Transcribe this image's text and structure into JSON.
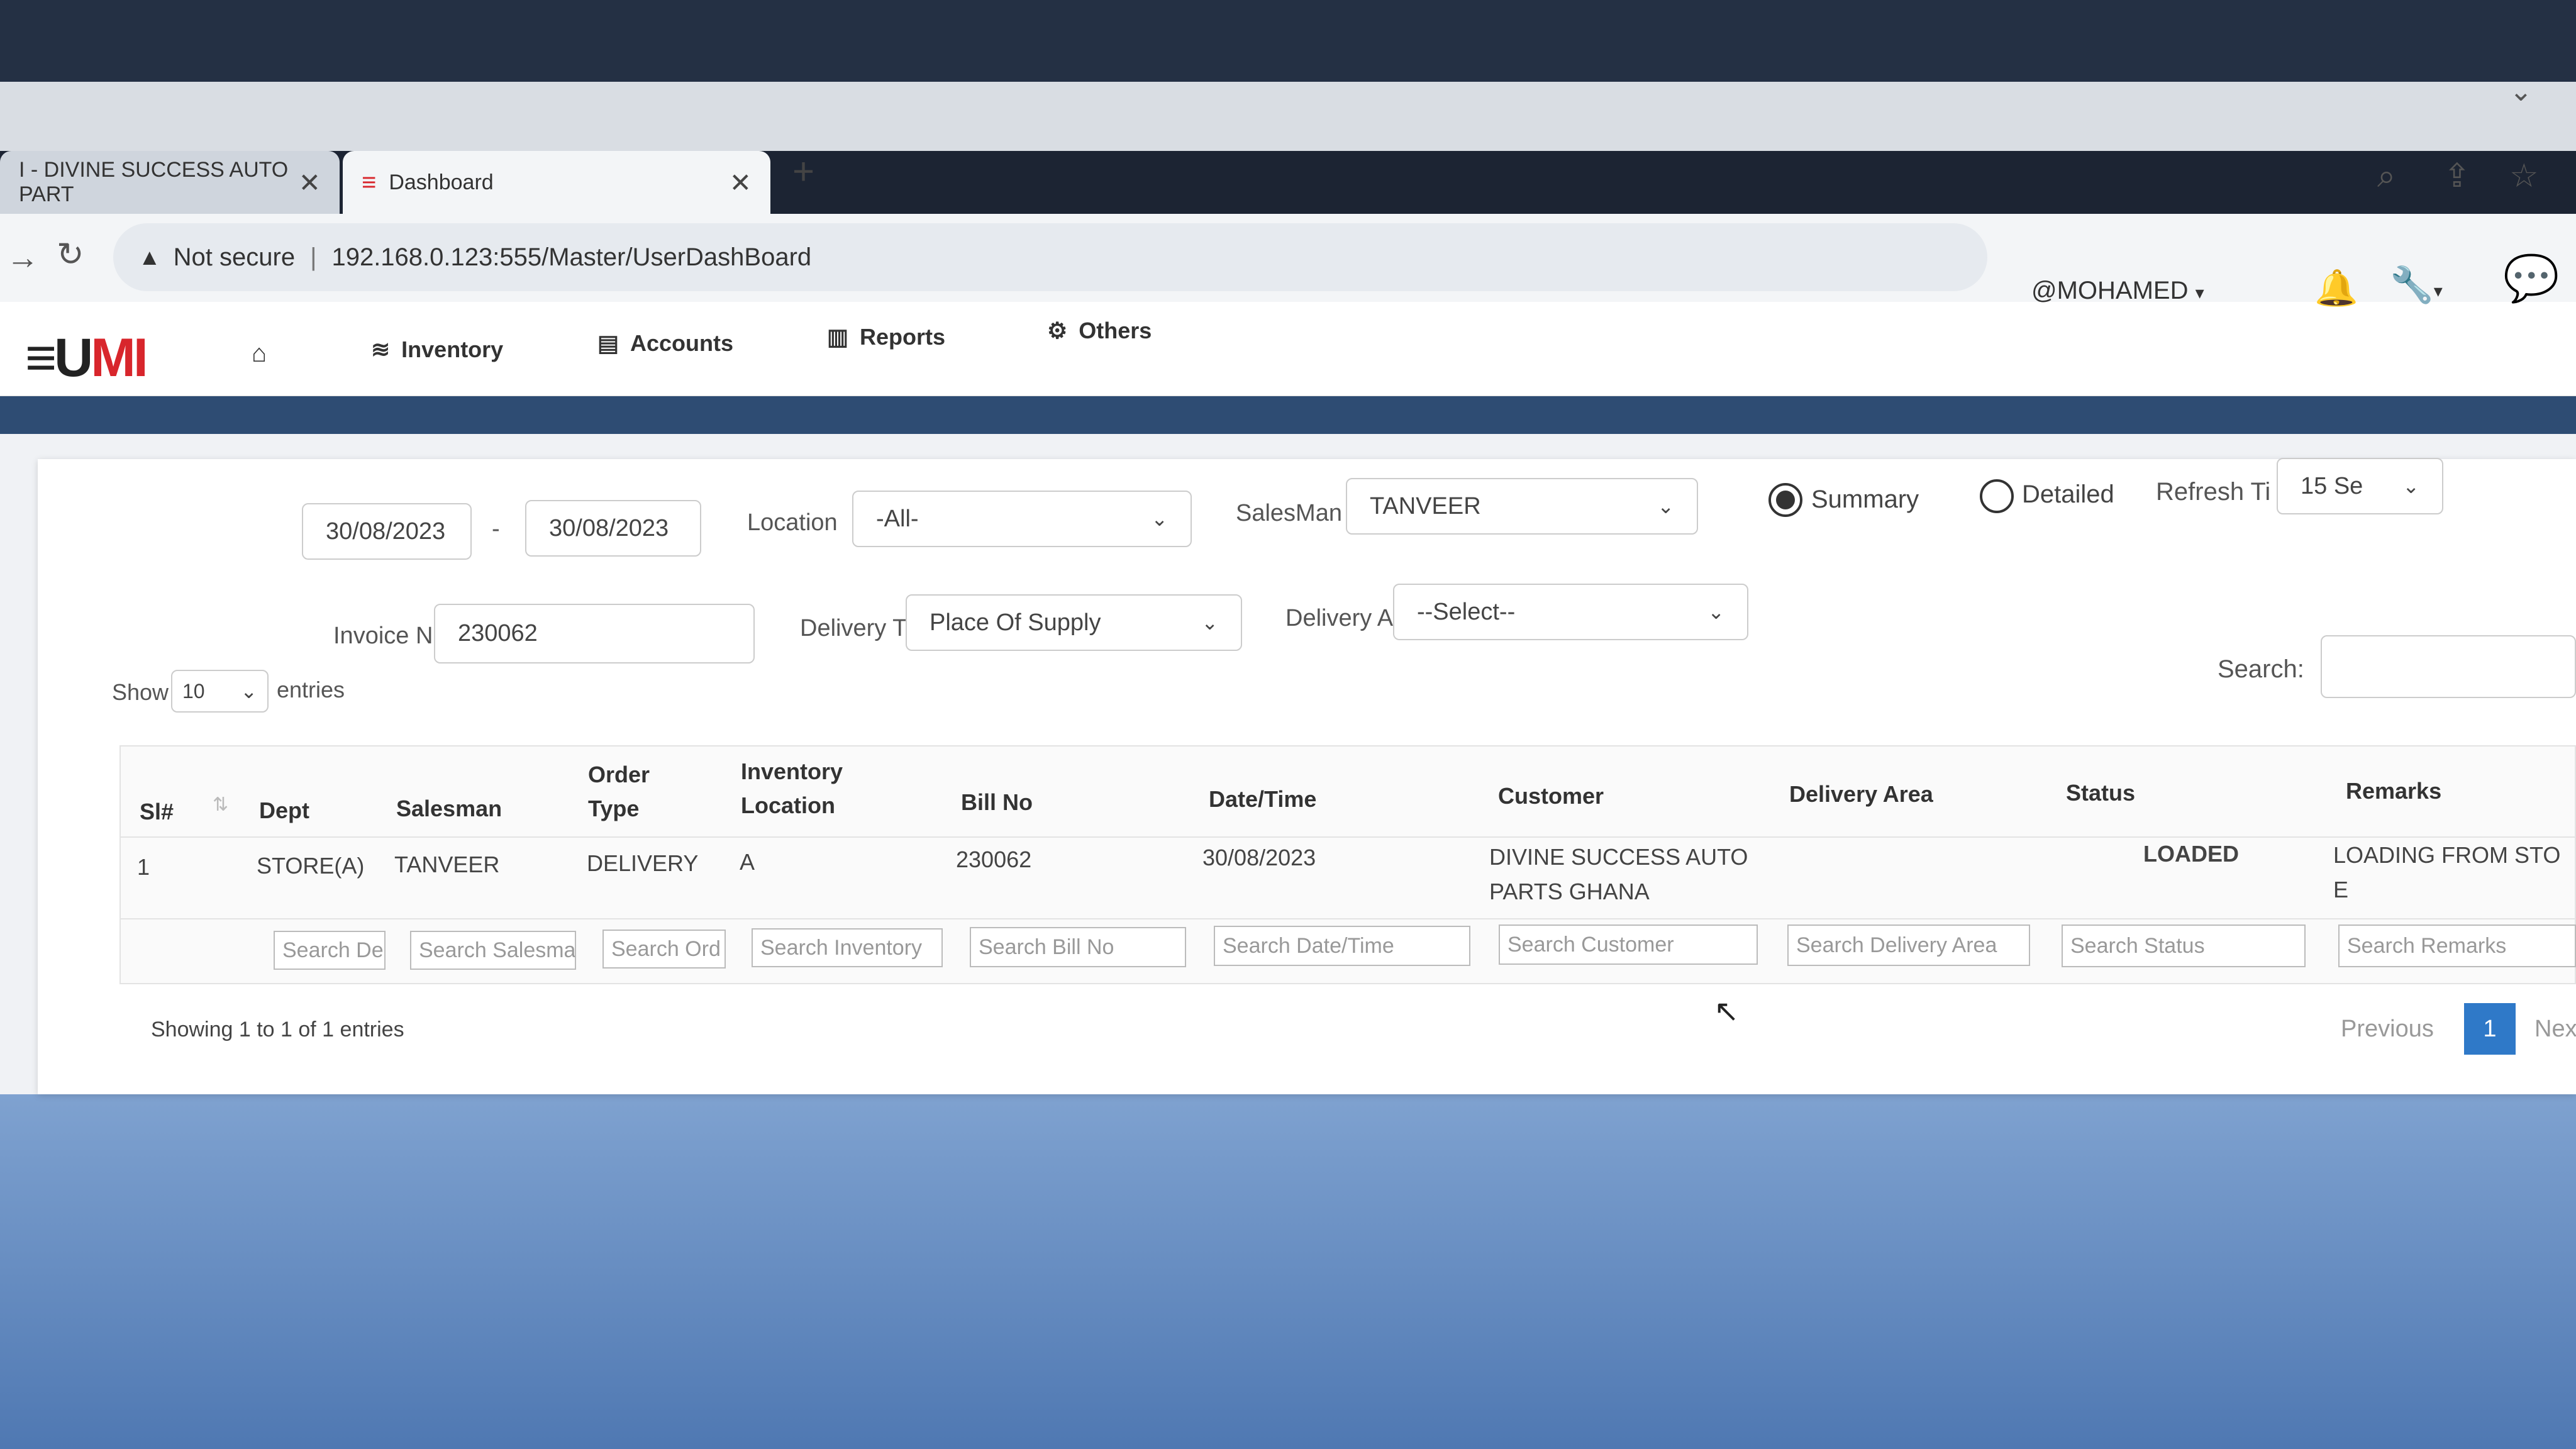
{
  "browser": {
    "tabs": [
      {
        "label": "I - DIVINE SUCCESS AUTO PART",
        "active": false
      },
      {
        "label": "Dashboard",
        "active": true
      }
    ],
    "security_label": "Not secure",
    "url": "192.168.0.123:555/Master/UserDashBoard"
  },
  "app": {
    "logo_main": "≡U",
    "logo_accent": "MI",
    "menu": [
      {
        "label": "Inventory",
        "icon": "layers-icon"
      },
      {
        "label": "Accounts",
        "icon": "table-icon"
      },
      {
        "label": "Reports",
        "icon": "bar-chart-icon"
      },
      {
        "label": "Others",
        "icon": "settings-icon"
      }
    ],
    "user": "@MOHAMED"
  },
  "filters": {
    "date_from": "30/08/2023",
    "date_sep": "-",
    "date_to": "30/08/2023",
    "location_label": "Location",
    "location_value": "-All-",
    "salesman_label": "SalesMan",
    "salesman_value": "TANVEER",
    "view_modes": [
      {
        "label": "Summary",
        "selected": true
      },
      {
        "label": "Detailed",
        "selected": false
      }
    ],
    "refresh_label": "Refresh Ti",
    "refresh_value": "15 Se",
    "invoice_label": "Invoice Nc",
    "invoice_value": "230062",
    "delivery_type_label": "Delivery T",
    "delivery_type_value": "Place Of Supply",
    "delivery_area_label": "Delivery A",
    "delivery_area_value": "--Select--"
  },
  "table": {
    "show_label": "Show",
    "show_value": "10",
    "entries_label": "entries",
    "search_label": "Search:",
    "columns": [
      "Sl#",
      "Dept",
      "Salesman",
      "Order Type",
      "Inventory Location",
      "Bill No",
      "Date/Time",
      "Customer",
      "Delivery Area",
      "Status",
      "Remarks"
    ],
    "rows": [
      {
        "sl": "1",
        "dept": "STORE(A)",
        "salesman": "TANVEER",
        "order_type": "DELIVERY",
        "location": "A",
        "bill_no": "230062",
        "date": "30/08/2023",
        "customer": "DIVINE SUCCESS AUTO PARTS GHANA",
        "delivery_area": "",
        "status": "LOADED",
        "remarks": "LOADING FROM STO E"
      }
    ],
    "column_search_placeholders": [
      "Search De",
      "Search Salesma",
      "Search Ord",
      "Search Inventory",
      "Search Bill No",
      "Search Date/Time",
      "Search Customer",
      "Search Delivery Area",
      "Search Status",
      "Search Remarks"
    ],
    "info": "Showing 1 to 1 of 1 entries",
    "pagination": {
      "previous": "Previous",
      "current": "1",
      "next": "Nex"
    }
  }
}
